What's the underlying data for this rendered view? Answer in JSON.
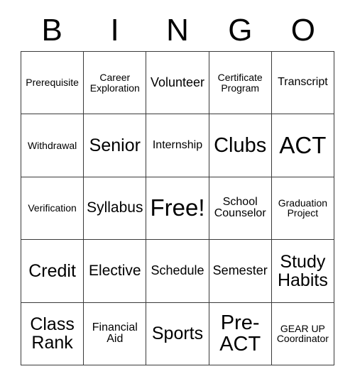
{
  "card": {
    "title": "BINGO",
    "header_letters": [
      "B",
      "I",
      "N",
      "G",
      "O"
    ],
    "columns": 5,
    "rows": 5,
    "border_color": "#3a3a3a",
    "background_color": "#ffffff",
    "text_color": "#000000",
    "free_space": "Free!",
    "cells": [
      {
        "text": "Prerequisite",
        "size": "sm",
        "row": 1,
        "col": 1
      },
      {
        "text": "Career\nExploration",
        "size": "sm",
        "row": 1,
        "col": 2
      },
      {
        "text": "Volunteer",
        "size": "lg",
        "row": 1,
        "col": 3
      },
      {
        "text": "Certificate\nProgram",
        "size": "sm",
        "row": 1,
        "col": 4
      },
      {
        "text": "Transcript",
        "size": "md",
        "row": 1,
        "col": 5
      },
      {
        "text": "Withdrawal",
        "size": "sm",
        "row": 2,
        "col": 1
      },
      {
        "text": "Senior",
        "size": "xxl",
        "row": 2,
        "col": 2
      },
      {
        "text": "Internship",
        "size": "md",
        "row": 2,
        "col": 3
      },
      {
        "text": "Clubs",
        "size": "huge",
        "row": 2,
        "col": 4
      },
      {
        "text": "ACT",
        "size": "mega",
        "row": 2,
        "col": 5
      },
      {
        "text": "Verification",
        "size": "sm",
        "row": 3,
        "col": 1
      },
      {
        "text": "Syllabus",
        "size": "xl",
        "row": 3,
        "col": 2
      },
      {
        "text": "Free!",
        "size": "mega",
        "row": 3,
        "col": 3
      },
      {
        "text": "School\nCounselor",
        "size": "md",
        "row": 3,
        "col": 4
      },
      {
        "text": "Graduation\nProject",
        "size": "sm",
        "row": 3,
        "col": 5
      },
      {
        "text": "Credit",
        "size": "xxl",
        "row": 4,
        "col": 1
      },
      {
        "text": "Elective",
        "size": "xl",
        "row": 4,
        "col": 2
      },
      {
        "text": "Schedule",
        "size": "lg",
        "row": 4,
        "col": 3
      },
      {
        "text": "Semester",
        "size": "lg",
        "row": 4,
        "col": 4
      },
      {
        "text": "Study\nHabits",
        "size": "xxl",
        "row": 4,
        "col": 5
      },
      {
        "text": "Class\nRank",
        "size": "xxl",
        "row": 5,
        "col": 1
      },
      {
        "text": "Financial\nAid",
        "size": "md",
        "row": 5,
        "col": 2
      },
      {
        "text": "Sports",
        "size": "xxl",
        "row": 5,
        "col": 3
      },
      {
        "text": "Pre-\nACT",
        "size": "huge",
        "row": 5,
        "col": 4
      },
      {
        "text": "GEAR UP\nCoordinator",
        "size": "sm",
        "row": 5,
        "col": 5
      }
    ]
  }
}
